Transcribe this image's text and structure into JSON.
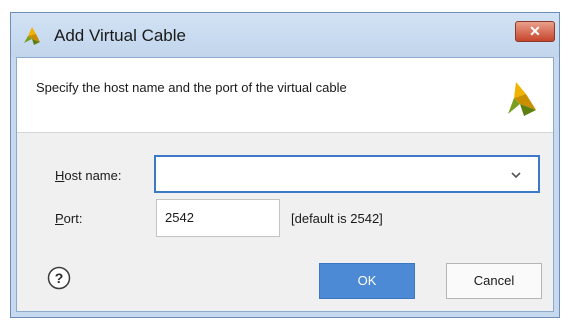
{
  "window": {
    "title": "Add Virtual Cable",
    "close_label": "✕"
  },
  "header": {
    "instruction": "Specify the host name and the port of the virtual cable"
  },
  "form": {
    "host": {
      "label_accel": "H",
      "label_rest": "ost name:",
      "value": ""
    },
    "port": {
      "label_accel": "P",
      "label_rest": "ort:",
      "value": "2542",
      "default_note": "[default is 2542]"
    }
  },
  "buttons": {
    "help": "?",
    "ok": "OK",
    "cancel": "Cancel"
  },
  "icons": {
    "app": "xilinx-logo-icon",
    "header": "xilinx-logo-icon",
    "combo": "chevron-down-icon",
    "help": "help-icon"
  },
  "colors": {
    "ok_button": "#4c8ad6",
    "focus_border": "#3d79c8",
    "logo_yellow": "#f0b400",
    "logo_green": "#7a9f1f",
    "close_button": "#c6452c"
  }
}
